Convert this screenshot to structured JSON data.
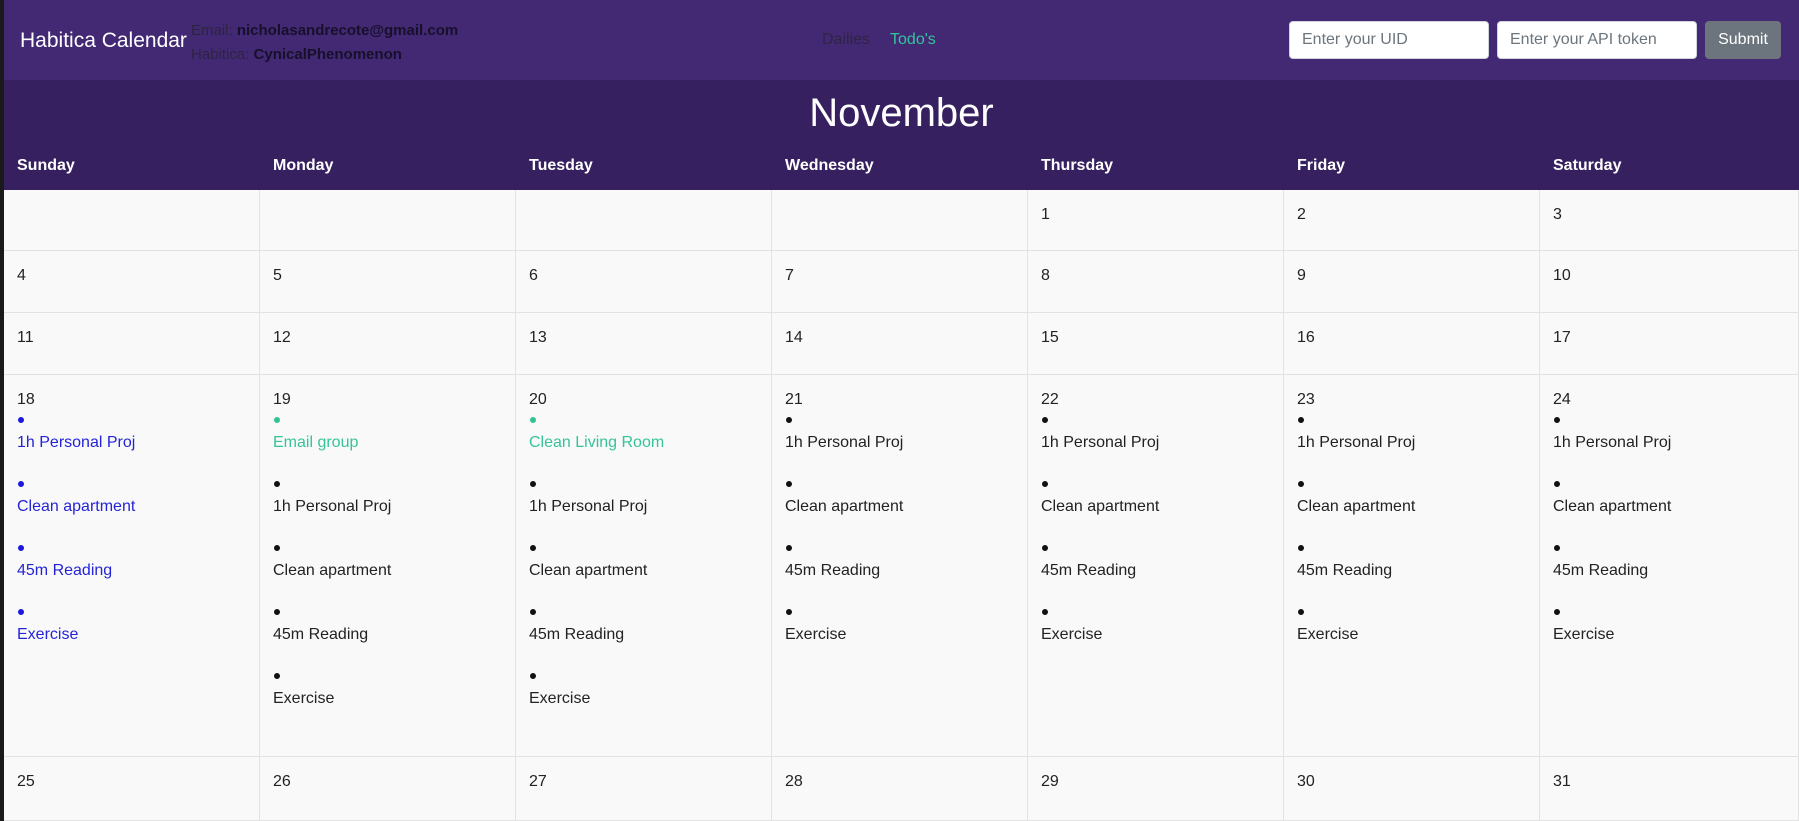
{
  "navbar": {
    "brand": "Habitica Calendar",
    "email_label": "Email: ",
    "email_value": "nicholasandrecote@gmail.com",
    "habitica_label": "Habitica: ",
    "habitica_value": "CynicalPhenomenon",
    "links": [
      "Dailies",
      "Todo's"
    ],
    "uid_placeholder": "Enter your UID",
    "token_placeholder": "Enter your API token",
    "submit_label": "Submit"
  },
  "calendar": {
    "month": "November",
    "weekdays": [
      "Sunday",
      "Monday",
      "Tuesday",
      "Wednesday",
      "Thursday",
      "Friday",
      "Saturday"
    ],
    "weeks": [
      [
        {
          "day": "",
          "tasks": []
        },
        {
          "day": "",
          "tasks": []
        },
        {
          "day": "",
          "tasks": []
        },
        {
          "day": "",
          "tasks": []
        },
        {
          "day": "1",
          "tasks": []
        },
        {
          "day": "2",
          "tasks": []
        },
        {
          "day": "3",
          "tasks": []
        }
      ],
      [
        {
          "day": "4",
          "tasks": []
        },
        {
          "day": "5",
          "tasks": []
        },
        {
          "day": "6",
          "tasks": []
        },
        {
          "day": "7",
          "tasks": []
        },
        {
          "day": "8",
          "tasks": []
        },
        {
          "day": "9",
          "tasks": []
        },
        {
          "day": "10",
          "tasks": []
        }
      ],
      [
        {
          "day": "11",
          "tasks": []
        },
        {
          "day": "12",
          "tasks": []
        },
        {
          "day": "13",
          "tasks": []
        },
        {
          "day": "14",
          "tasks": []
        },
        {
          "day": "15",
          "tasks": []
        },
        {
          "day": "16",
          "tasks": []
        },
        {
          "day": "17",
          "tasks": []
        }
      ],
      [
        {
          "day": "18",
          "tasks": [
            {
              "label": "1h Personal Proj",
              "color": "blue"
            },
            {
              "label": "Clean apartment",
              "color": "blue"
            },
            {
              "label": "45m Reading",
              "color": "blue"
            },
            {
              "label": "Exercise",
              "color": "blue"
            }
          ]
        },
        {
          "day": "19",
          "tasks": [
            {
              "label": "Email group",
              "color": "green"
            },
            {
              "label": "1h Personal Proj",
              "color": "black"
            },
            {
              "label": "Clean apartment",
              "color": "black"
            },
            {
              "label": "45m Reading",
              "color": "black"
            },
            {
              "label": "Exercise",
              "color": "black"
            }
          ]
        },
        {
          "day": "20",
          "tasks": [
            {
              "label": "Clean Living Room",
              "color": "green"
            },
            {
              "label": "1h Personal Proj",
              "color": "black"
            },
            {
              "label": "Clean apartment",
              "color": "black"
            },
            {
              "label": "45m Reading",
              "color": "black"
            },
            {
              "label": "Exercise",
              "color": "black"
            }
          ]
        },
        {
          "day": "21",
          "tasks": [
            {
              "label": "1h Personal Proj",
              "color": "black"
            },
            {
              "label": "Clean apartment",
              "color": "black"
            },
            {
              "label": "45m Reading",
              "color": "black"
            },
            {
              "label": "Exercise",
              "color": "black"
            }
          ]
        },
        {
          "day": "22",
          "tasks": [
            {
              "label": "1h Personal Proj",
              "color": "black"
            },
            {
              "label": "Clean apartment",
              "color": "black"
            },
            {
              "label": "45m Reading",
              "color": "black"
            },
            {
              "label": "Exercise",
              "color": "black"
            }
          ]
        },
        {
          "day": "23",
          "tasks": [
            {
              "label": "1h Personal Proj",
              "color": "black"
            },
            {
              "label": "Clean apartment",
              "color": "black"
            },
            {
              "label": "45m Reading",
              "color": "black"
            },
            {
              "label": "Exercise",
              "color": "black"
            }
          ]
        },
        {
          "day": "24",
          "tasks": [
            {
              "label": "1h Personal Proj",
              "color": "black"
            },
            {
              "label": "Clean apartment",
              "color": "black"
            },
            {
              "label": "45m Reading",
              "color": "black"
            },
            {
              "label": "Exercise",
              "color": "black"
            }
          ]
        }
      ],
      [
        {
          "day": "25",
          "tasks": []
        },
        {
          "day": "26",
          "tasks": []
        },
        {
          "day": "27",
          "tasks": []
        },
        {
          "day": "28",
          "tasks": []
        },
        {
          "day": "29",
          "tasks": []
        },
        {
          "day": "30",
          "tasks": []
        },
        {
          "day": "31",
          "tasks": []
        }
      ]
    ]
  },
  "colors": {
    "navbar_bg": "#432874",
    "header_bg": "#36205f",
    "today_task": "#2424d6",
    "todo_task": "#35c49a"
  }
}
